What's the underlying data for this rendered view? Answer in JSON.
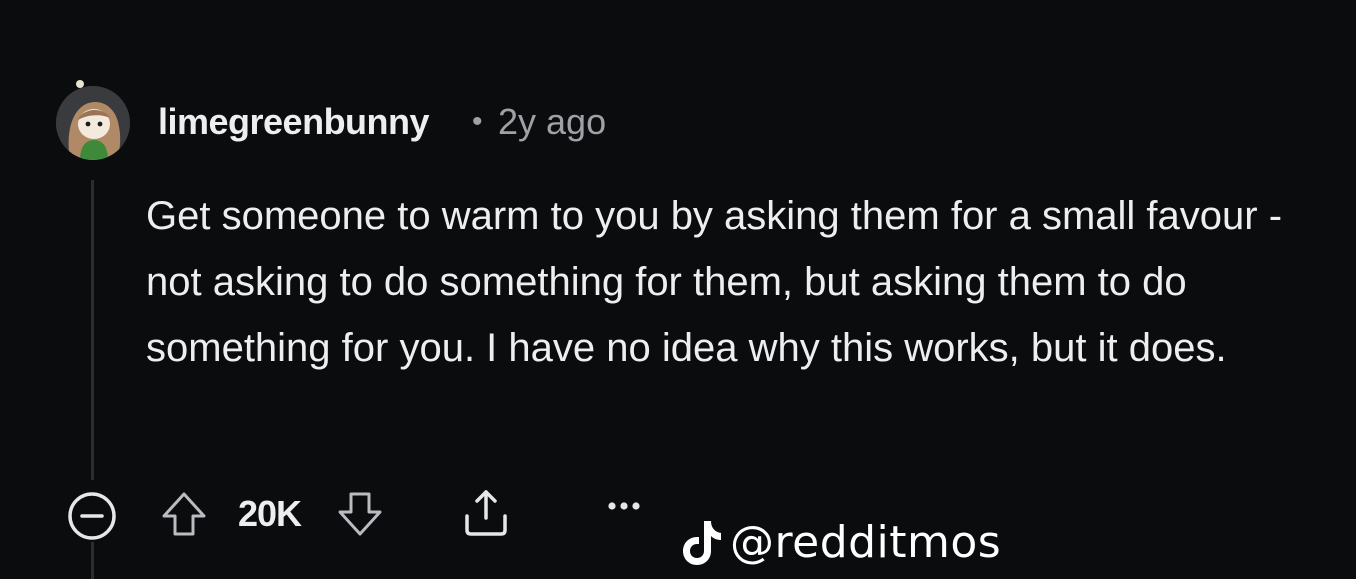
{
  "comment": {
    "username": "limegreenbunny",
    "separator": "•",
    "timestamp": "2y ago",
    "body": "Get someone to warm to you by asking them for a small favour - not asking to do something for them, but asking them to do something for you. I have no idea why this works, but it does.",
    "avatar_icon": "user-avatar-icon"
  },
  "actions": {
    "collapse_icon": "collapse-minus-icon",
    "upvote_icon": "upvote-arrow-icon",
    "vote_count": "20K",
    "downvote_icon": "downvote-arrow-icon",
    "share_icon": "share-icon",
    "more_icon": "more-dots-icon"
  },
  "watermark": {
    "logo_icon": "tiktok-logo-icon",
    "handle": "@redditmos"
  },
  "colors": {
    "background": "#0b0c0e",
    "text": "#eceef0",
    "muted": "#9ea1a6",
    "icon": "#b9bcc1",
    "thread_line": "#2b2d31"
  }
}
